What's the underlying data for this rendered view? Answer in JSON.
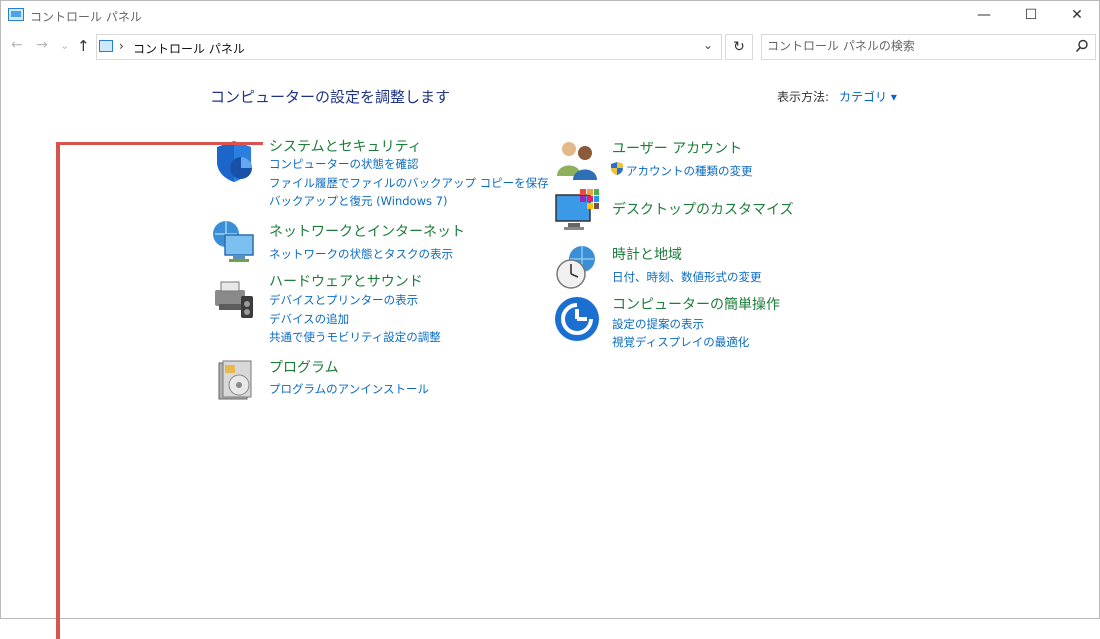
{
  "window": {
    "title": "コントロール パネル",
    "controls": {
      "minimize": "—",
      "maximize": "☐",
      "close": "✕"
    }
  },
  "addressbar": {
    "back": "←",
    "forward": "→",
    "recent": "⌄",
    "up": "↑",
    "separator": "›",
    "path": "コントロール パネル",
    "dropdown": "⌄",
    "refresh": "↻",
    "search_placeholder": "コントロール パネルの検索"
  },
  "main": {
    "heading": "コンピューターの設定を調整します",
    "view_by_label": "表示方法:",
    "view_by_value": "カテゴリ ▾"
  },
  "categories": {
    "system": {
      "title": "システムとセキュリティ",
      "links": [
        "コンピューターの状態を確認",
        "ファイル履歴でファイルのバックアップ コピーを保存",
        "バックアップと復元 (Windows 7)"
      ]
    },
    "network": {
      "title": "ネットワークとインターネット",
      "links": [
        "ネットワークの状態とタスクの表示"
      ]
    },
    "hardware": {
      "title": "ハードウェアとサウンド",
      "links": [
        "デバイスとプリンターの表示",
        "デバイスの追加",
        "共通で使うモビリティ設定の調整"
      ]
    },
    "programs": {
      "title": "プログラム",
      "links": [
        "プログラムのアンインストール"
      ]
    },
    "user": {
      "title": "ユーザー アカウント",
      "links": [
        "アカウントの種類の変更"
      ]
    },
    "desktop": {
      "title": "デスクトップのカスタマイズ",
      "links": []
    },
    "clock": {
      "title": "時計と地域",
      "links": [
        "日付、時刻、数値形式の変更"
      ]
    },
    "access": {
      "title": "コンピューターの簡単操作",
      "links": [
        "設定の提案の表示",
        "視覚ディスプレイの最適化"
      ]
    }
  },
  "colors": {
    "heading": "#1e3287",
    "category_title": "#1e7d3a",
    "link": "#0b6bc2",
    "annotation": "#d9534f"
  }
}
